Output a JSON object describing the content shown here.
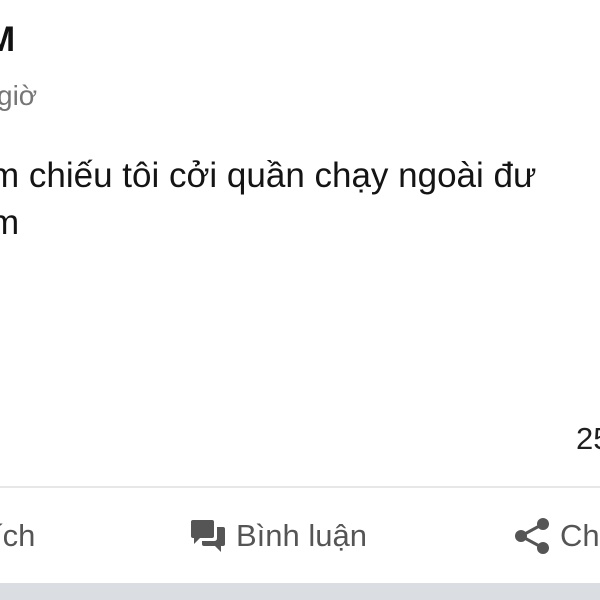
{
  "post": {
    "author_name": "M",
    "time_text": "giờ",
    "text_lines": [
      "m chiếu tôi cởi quần chạy ngoài đư",
      "m"
    ],
    "reaction_count": "25"
  },
  "actions": {
    "like_label": "ích",
    "comment_label": "Bình luận",
    "share_label": "Ch"
  },
  "icons": {
    "comment": "comment-bubbles-icon",
    "share": "share-icon"
  },
  "colors": {
    "text_primary": "#141414",
    "text_secondary": "#767676",
    "action_text": "#555555",
    "divider": "#e7e7e7",
    "bottom_strip": "#dadde1"
  }
}
